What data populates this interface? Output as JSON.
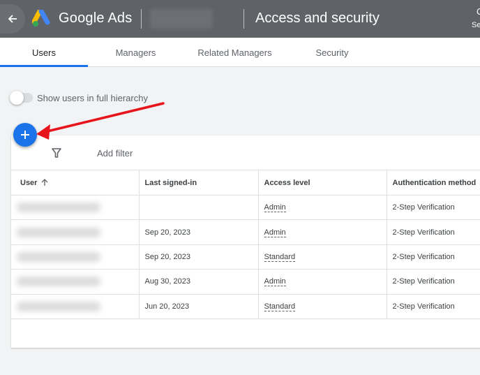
{
  "header": {
    "back_icon": "arrow-left-icon",
    "brand": "Google Ads",
    "page_title": "Access and security",
    "right_top": "C",
    "right_sub": "Se"
  },
  "tabs": [
    {
      "label": "Users",
      "active": true
    },
    {
      "label": "Managers",
      "active": false
    },
    {
      "label": "Related Managers",
      "active": false
    },
    {
      "label": "Security",
      "active": false
    }
  ],
  "toggle": {
    "label": "Show users in full hierarchy",
    "on": false
  },
  "add_button": {
    "icon": "plus-icon"
  },
  "filter": {
    "icon": "filter-icon",
    "label": "Add filter"
  },
  "table": {
    "columns": [
      "User",
      "Last signed-in",
      "Access level",
      "Authentication method"
    ],
    "sort_icon": "arrow-up-icon",
    "rows": [
      {
        "last_signed_in": "",
        "access_level": "Admin",
        "auth_method": "2-Step Verification"
      },
      {
        "last_signed_in": "Sep 20, 2023",
        "access_level": "Admin",
        "auth_method": "2-Step Verification"
      },
      {
        "last_signed_in": "Sep 20, 2023",
        "access_level": "Standard",
        "auth_method": "2-Step Verification"
      },
      {
        "last_signed_in": "Aug 30, 2023",
        "access_level": "Admin",
        "auth_method": "2-Step Verification"
      },
      {
        "last_signed_in": "Jun 20, 2023",
        "access_level": "Standard",
        "auth_method": "2-Step Verification"
      }
    ]
  },
  "annotation": {
    "type": "red-arrow",
    "color": "#e8141c",
    "points_to": "add-user-button"
  },
  "colors": {
    "topbar": "#5f6368",
    "accent": "#1a73e8",
    "background": "#f1f3f4"
  }
}
